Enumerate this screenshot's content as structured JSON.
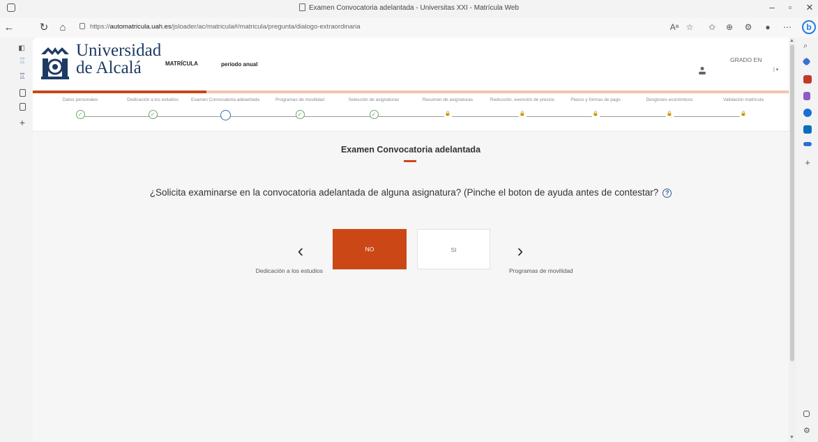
{
  "browser": {
    "window_title": "Examen Convocatoria adelantada - Universitas XXI - Matrícula Web",
    "url_prefix": "https://",
    "url_host": "automatricula.uah.es",
    "url_path": "/jsloader/ac/matricula#/matricula/pregunta/dialogo-extraordinaria"
  },
  "header": {
    "logo_line1": "Universidad",
    "logo_line2": "de Alcalá",
    "matricula": "MATRÍCULA",
    "periodo": "periodo anual",
    "grado": "GRADO EN"
  },
  "steps": [
    {
      "label": "Datos personales",
      "state": "done"
    },
    {
      "label": "Dedicación a los estudios",
      "state": "done"
    },
    {
      "label": "Examen Convocatoria adelantada",
      "state": "current"
    },
    {
      "label": "Programas de movilidad",
      "state": "done"
    },
    {
      "label": "Selección de asignaturas",
      "state": "done"
    },
    {
      "label": "Resumen de asignaturas",
      "state": "locked"
    },
    {
      "label": "Reducción, exención de precios",
      "state": "locked"
    },
    {
      "label": "Plazos y formas de pago",
      "state": "locked"
    },
    {
      "label": "Desgloses económicos",
      "state": "locked"
    },
    {
      "label": "Validación matrícula",
      "state": "locked"
    }
  ],
  "main": {
    "title": "Examen Convocatoria adelantada",
    "question": "¿Solicita examinarse en la convocatoria adelantada de alguna asignatura? (Pinche el boton de ayuda antes de contestar?",
    "help_symbol": "?",
    "btn_no": "NO",
    "btn_si": "SI",
    "prev_label": "Dedicación a los estudios",
    "next_label": "Programas de movilidad"
  },
  "colors": {
    "accent": "#cc4716",
    "progress_track": "#f5c2b2",
    "logo_blue": "#1d3a64",
    "check_green": "#6aa86a"
  },
  "progress_fraction": 0.23
}
